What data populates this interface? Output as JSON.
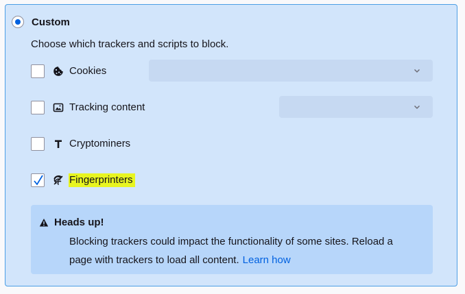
{
  "custom": {
    "label": "Custom",
    "selected": true,
    "description": "Choose which trackers and scripts to block."
  },
  "options": [
    {
      "label": "Cookies",
      "checked": false,
      "icon": "cookie-icon",
      "has_select": true,
      "select_value": ""
    },
    {
      "label": "Tracking content",
      "checked": false,
      "icon": "image-icon",
      "has_select": true,
      "select_value": ""
    },
    {
      "label": "Cryptominers",
      "checked": false,
      "icon": "hammer-icon",
      "has_select": false
    },
    {
      "label": "Fingerprinters",
      "checked": true,
      "icon": "fingerprint-icon",
      "has_select": false,
      "highlighted": true
    }
  ],
  "notice": {
    "icon": "warning-icon",
    "title": "Heads up!",
    "body": "Blocking trackers could impact the functionality of some sites. Reload a page with trackers to load all content.",
    "link": "Learn how"
  },
  "colors": {
    "panel_bg": "#d2e5fb",
    "panel_border": "#4b9ee5",
    "accent": "#0061e0",
    "highlight": "#e8f520",
    "notice_bg": "#b7d6fa",
    "select_bg": "#c6d9f2"
  }
}
